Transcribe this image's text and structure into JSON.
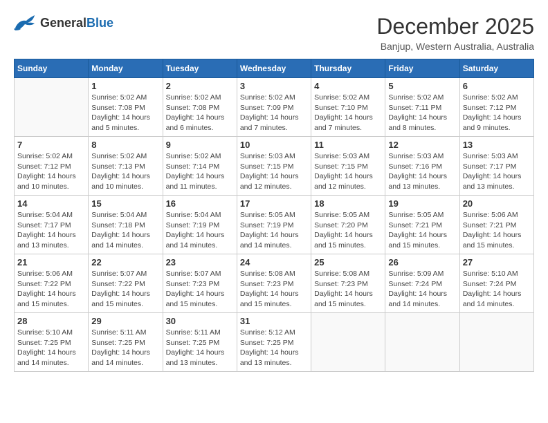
{
  "header": {
    "logo_general": "General",
    "logo_blue": "Blue",
    "title": "December 2025",
    "subtitle": "Banjup, Western Australia, Australia"
  },
  "calendar": {
    "days_of_week": [
      "Sunday",
      "Monday",
      "Tuesday",
      "Wednesday",
      "Thursday",
      "Friday",
      "Saturday"
    ],
    "weeks": [
      [
        {
          "day": "",
          "info": ""
        },
        {
          "day": "1",
          "info": "Sunrise: 5:02 AM\nSunset: 7:08 PM\nDaylight: 14 hours\nand 5 minutes."
        },
        {
          "day": "2",
          "info": "Sunrise: 5:02 AM\nSunset: 7:08 PM\nDaylight: 14 hours\nand 6 minutes."
        },
        {
          "day": "3",
          "info": "Sunrise: 5:02 AM\nSunset: 7:09 PM\nDaylight: 14 hours\nand 7 minutes."
        },
        {
          "day": "4",
          "info": "Sunrise: 5:02 AM\nSunset: 7:10 PM\nDaylight: 14 hours\nand 7 minutes."
        },
        {
          "day": "5",
          "info": "Sunrise: 5:02 AM\nSunset: 7:11 PM\nDaylight: 14 hours\nand 8 minutes."
        },
        {
          "day": "6",
          "info": "Sunrise: 5:02 AM\nSunset: 7:12 PM\nDaylight: 14 hours\nand 9 minutes."
        }
      ],
      [
        {
          "day": "7",
          "info": "Sunrise: 5:02 AM\nSunset: 7:12 PM\nDaylight: 14 hours\nand 10 minutes."
        },
        {
          "day": "8",
          "info": "Sunrise: 5:02 AM\nSunset: 7:13 PM\nDaylight: 14 hours\nand 10 minutes."
        },
        {
          "day": "9",
          "info": "Sunrise: 5:02 AM\nSunset: 7:14 PM\nDaylight: 14 hours\nand 11 minutes."
        },
        {
          "day": "10",
          "info": "Sunrise: 5:03 AM\nSunset: 7:15 PM\nDaylight: 14 hours\nand 12 minutes."
        },
        {
          "day": "11",
          "info": "Sunrise: 5:03 AM\nSunset: 7:15 PM\nDaylight: 14 hours\nand 12 minutes."
        },
        {
          "day": "12",
          "info": "Sunrise: 5:03 AM\nSunset: 7:16 PM\nDaylight: 14 hours\nand 13 minutes."
        },
        {
          "day": "13",
          "info": "Sunrise: 5:03 AM\nSunset: 7:17 PM\nDaylight: 14 hours\nand 13 minutes."
        }
      ],
      [
        {
          "day": "14",
          "info": "Sunrise: 5:04 AM\nSunset: 7:17 PM\nDaylight: 14 hours\nand 13 minutes."
        },
        {
          "day": "15",
          "info": "Sunrise: 5:04 AM\nSunset: 7:18 PM\nDaylight: 14 hours\nand 14 minutes."
        },
        {
          "day": "16",
          "info": "Sunrise: 5:04 AM\nSunset: 7:19 PM\nDaylight: 14 hours\nand 14 minutes."
        },
        {
          "day": "17",
          "info": "Sunrise: 5:05 AM\nSunset: 7:19 PM\nDaylight: 14 hours\nand 14 minutes."
        },
        {
          "day": "18",
          "info": "Sunrise: 5:05 AM\nSunset: 7:20 PM\nDaylight: 14 hours\nand 15 minutes."
        },
        {
          "day": "19",
          "info": "Sunrise: 5:05 AM\nSunset: 7:21 PM\nDaylight: 14 hours\nand 15 minutes."
        },
        {
          "day": "20",
          "info": "Sunrise: 5:06 AM\nSunset: 7:21 PM\nDaylight: 14 hours\nand 15 minutes."
        }
      ],
      [
        {
          "day": "21",
          "info": "Sunrise: 5:06 AM\nSunset: 7:22 PM\nDaylight: 14 hours\nand 15 minutes."
        },
        {
          "day": "22",
          "info": "Sunrise: 5:07 AM\nSunset: 7:22 PM\nDaylight: 14 hours\nand 15 minutes."
        },
        {
          "day": "23",
          "info": "Sunrise: 5:07 AM\nSunset: 7:23 PM\nDaylight: 14 hours\nand 15 minutes."
        },
        {
          "day": "24",
          "info": "Sunrise: 5:08 AM\nSunset: 7:23 PM\nDaylight: 14 hours\nand 15 minutes."
        },
        {
          "day": "25",
          "info": "Sunrise: 5:08 AM\nSunset: 7:23 PM\nDaylight: 14 hours\nand 15 minutes."
        },
        {
          "day": "26",
          "info": "Sunrise: 5:09 AM\nSunset: 7:24 PM\nDaylight: 14 hours\nand 14 minutes."
        },
        {
          "day": "27",
          "info": "Sunrise: 5:10 AM\nSunset: 7:24 PM\nDaylight: 14 hours\nand 14 minutes."
        }
      ],
      [
        {
          "day": "28",
          "info": "Sunrise: 5:10 AM\nSunset: 7:25 PM\nDaylight: 14 hours\nand 14 minutes."
        },
        {
          "day": "29",
          "info": "Sunrise: 5:11 AM\nSunset: 7:25 PM\nDaylight: 14 hours\nand 14 minutes."
        },
        {
          "day": "30",
          "info": "Sunrise: 5:11 AM\nSunset: 7:25 PM\nDaylight: 14 hours\nand 13 minutes."
        },
        {
          "day": "31",
          "info": "Sunrise: 5:12 AM\nSunset: 7:25 PM\nDaylight: 14 hours\nand 13 minutes."
        },
        {
          "day": "",
          "info": ""
        },
        {
          "day": "",
          "info": ""
        },
        {
          "day": "",
          "info": ""
        }
      ]
    ]
  }
}
